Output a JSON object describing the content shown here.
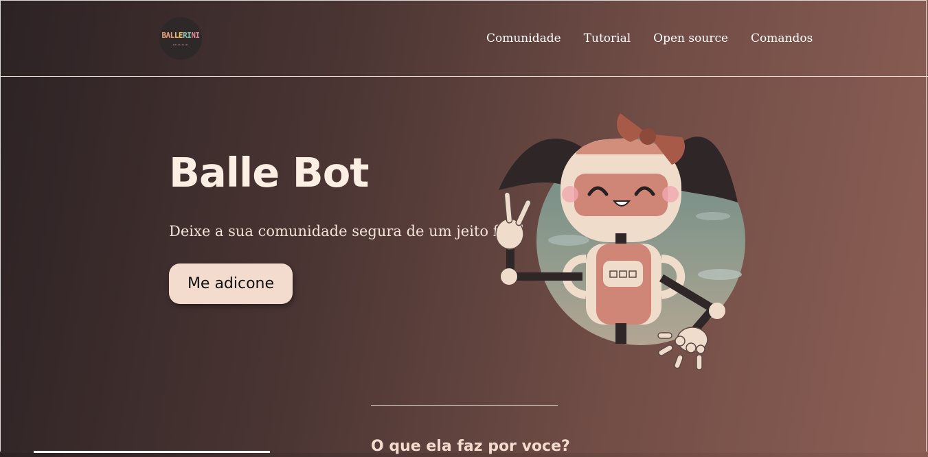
{
  "header": {
    "logo": {
      "letters": [
        "BAL",
        "LE",
        "RI",
        "NI"
      ],
      "alt_icon": "ballerini-logo"
    },
    "nav": [
      {
        "label": "Comunidade"
      },
      {
        "label": "Tutorial"
      },
      {
        "label": "Open source"
      },
      {
        "label": "Comandos"
      }
    ]
  },
  "hero": {
    "title": "Balle Bot",
    "subtitle": "Deixe a sua comunidade segura de um jeito facil",
    "cta_label": "Me adicone",
    "illustration_icon": "robot-girl-illustration"
  },
  "section": {
    "title": "O que ela faz por voce?"
  },
  "colors": {
    "bg_dark": "#2c2224",
    "bg_light": "#8c5f55",
    "cream": "#f3dccd",
    "accent_pink": "#cf8677"
  }
}
